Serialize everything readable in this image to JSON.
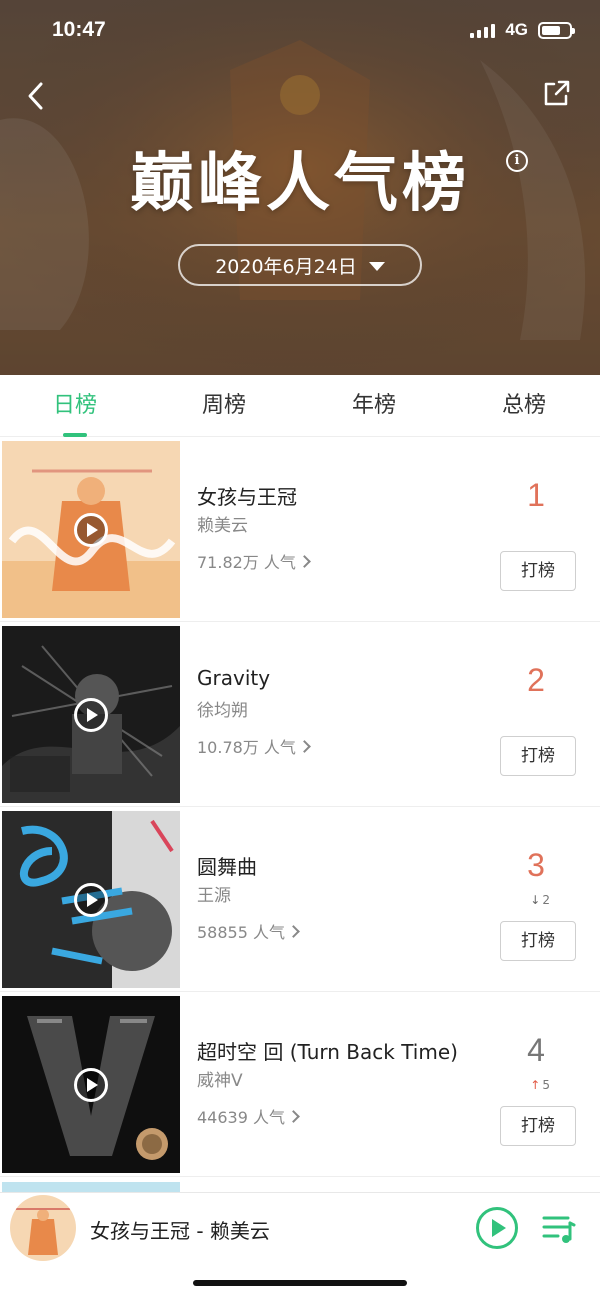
{
  "status": {
    "time": "10:47",
    "network": "4G"
  },
  "header": {
    "title": "巅峰人气榜",
    "info_symbol": "i",
    "date": "2020年6月24日"
  },
  "tabs": [
    {
      "label": "日榜",
      "active": true
    },
    {
      "label": "周榜",
      "active": false
    },
    {
      "label": "年榜",
      "active": false
    },
    {
      "label": "总榜",
      "active": false
    }
  ],
  "songs": [
    {
      "rank": "1",
      "title": "女孩与王冠",
      "artist": "赖美云",
      "popularity": "71.82万 人气",
      "vote": "打榜",
      "trend": null
    },
    {
      "rank": "2",
      "title": "Gravity",
      "artist": "徐均朔",
      "popularity": "10.78万 人气",
      "vote": "打榜",
      "trend": null
    },
    {
      "rank": "3",
      "title": "圆舞曲",
      "artist": "王源",
      "popularity": "58855 人气",
      "vote": "打榜",
      "trend": {
        "dir": "down",
        "arrow": "↓",
        "value": "2"
      }
    },
    {
      "rank": "4",
      "title": "超时空 回 (Turn Back Time)",
      "artist": "威神V",
      "popularity": "44639 人气",
      "vote": "打榜",
      "trend": {
        "dir": "up",
        "arrow": "↑",
        "value": "5"
      }
    }
  ],
  "player": {
    "now_playing": "女孩与王冠 - 赖美云"
  },
  "colors": {
    "accent": "#31c27c",
    "rank_top": "#e0725a"
  },
  "icons": [
    "back-icon",
    "share-icon",
    "info-icon",
    "caret-down-icon",
    "play-icon",
    "chevron-right-icon",
    "playlist-icon"
  ]
}
